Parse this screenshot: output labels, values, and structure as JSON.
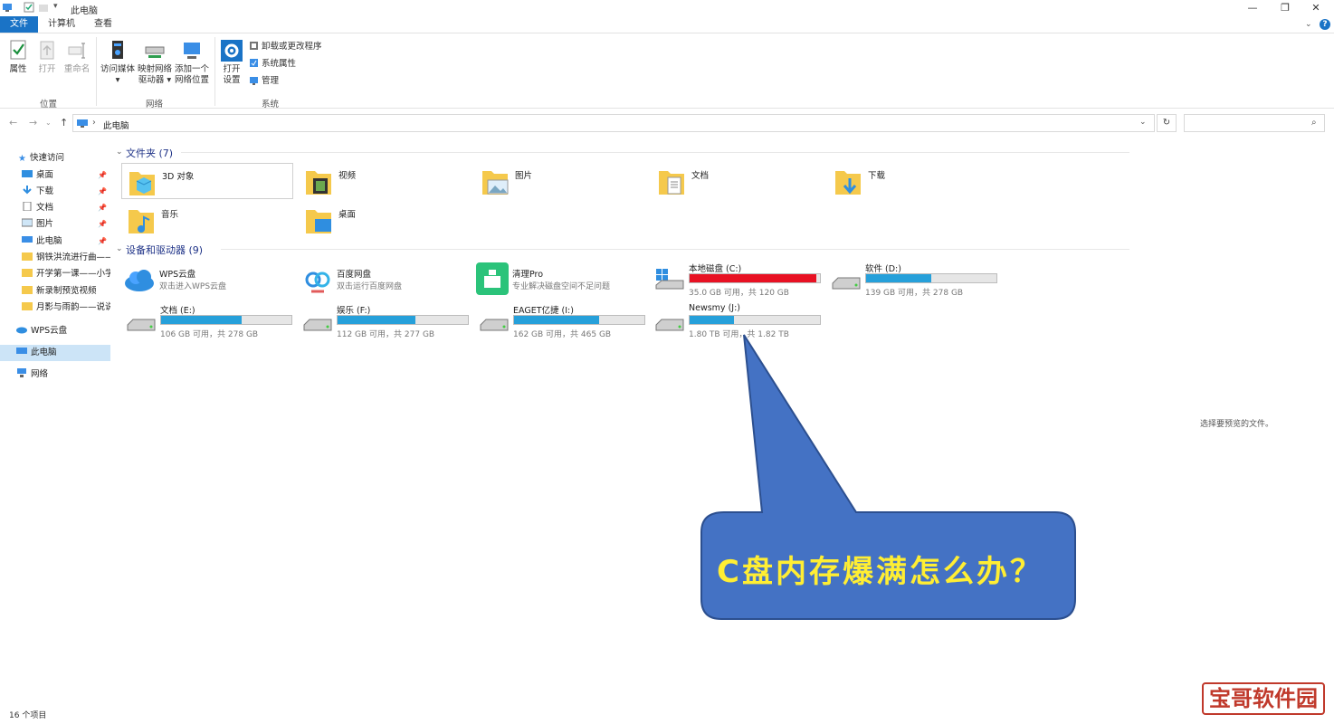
{
  "window": {
    "title": "此电脑",
    "minimize": "—",
    "maximize": "❐",
    "close": "✕"
  },
  "ribbon": {
    "tabs": [
      "文件",
      "计算机",
      "查看"
    ],
    "groups": {
      "location": {
        "label": "位置",
        "buttons": [
          "属性",
          "打开",
          "重命名"
        ]
      },
      "network": {
        "label": "网络",
        "buttons": [
          {
            "line1": "访问媒体",
            "line2": "▾"
          },
          {
            "line1": "映射网络",
            "line2": "驱动器 ▾"
          },
          {
            "line1": "添加一个",
            "line2": "网络位置"
          }
        ]
      },
      "system": {
        "label": "系统",
        "open_settings_line1": "打开",
        "open_settings_line2": "设置",
        "small_buttons": [
          "卸载或更改程序",
          "系统属性",
          "管理"
        ]
      }
    }
  },
  "address": {
    "path": "此电脑",
    "separator": "›"
  },
  "sidebar": {
    "quick_access": "快速访问",
    "items": [
      {
        "label": "桌面",
        "pinned": true
      },
      {
        "label": "下载",
        "pinned": true
      },
      {
        "label": "文档",
        "pinned": true
      },
      {
        "label": "图片",
        "pinned": true
      },
      {
        "label": "此电脑",
        "pinned": true
      },
      {
        "label": "钢铁洪流进行曲——",
        "pinned": false
      },
      {
        "label": "开学第一课——小学",
        "pinned": false
      },
      {
        "label": "新录制预览视频",
        "pinned": false
      },
      {
        "label": "月影与雨韵——说说",
        "pinned": false
      }
    ],
    "wps_cloud": "WPS云盘",
    "this_pc": "此电脑",
    "network": "网络"
  },
  "folders_section": {
    "header": "文件夹 (7)",
    "items": [
      "3D 对象",
      "视频",
      "图片",
      "文档",
      "下载",
      "音乐",
      "桌面"
    ]
  },
  "devices_section": {
    "header": "设备和驱动器 (9)",
    "apps": [
      {
        "name": "WPS云盘",
        "desc": "双击进入WPS云盘"
      },
      {
        "name": "百度网盘",
        "desc": "双击运行百度网盘"
      },
      {
        "name": "清理Pro",
        "desc": "专业解决磁盘空间不足问题"
      }
    ],
    "drives": [
      {
        "name": "本地磁盘 (C:)",
        "size": "35.0 GB 可用，共 120 GB",
        "used_fraction": 0.97,
        "color": "#e81123"
      },
      {
        "name": "软件 (D:)",
        "size": "139 GB 可用，共 278 GB",
        "used_fraction": 0.5,
        "color": "#26a0da"
      },
      {
        "name": "文档 (E:)",
        "size": "106 GB 可用，共 278 GB",
        "used_fraction": 0.62,
        "color": "#26a0da"
      },
      {
        "name": "娱乐 (F:)",
        "size": "112 GB 可用，共 277 GB",
        "used_fraction": 0.6,
        "color": "#26a0da"
      },
      {
        "name": "EAGET亿捷 (I:)",
        "size": "162 GB 可用，共 465 GB",
        "used_fraction": 0.65,
        "color": "#26a0da"
      },
      {
        "name": "Newsmy (J:)",
        "size": "1.80 TB 可用，共 1.82 TB",
        "used_fraction": 0.34,
        "color": "#26a0da"
      }
    ]
  },
  "preview_pane": {
    "message": "选择要预览的文件。"
  },
  "status_bar": {
    "count": "16 个项目"
  },
  "callout": {
    "text": "C盘内存爆满怎么办？",
    "fill": "#4472c4",
    "text_color": "#ffee33"
  },
  "watermark": {
    "text": "宝哥软件园"
  }
}
